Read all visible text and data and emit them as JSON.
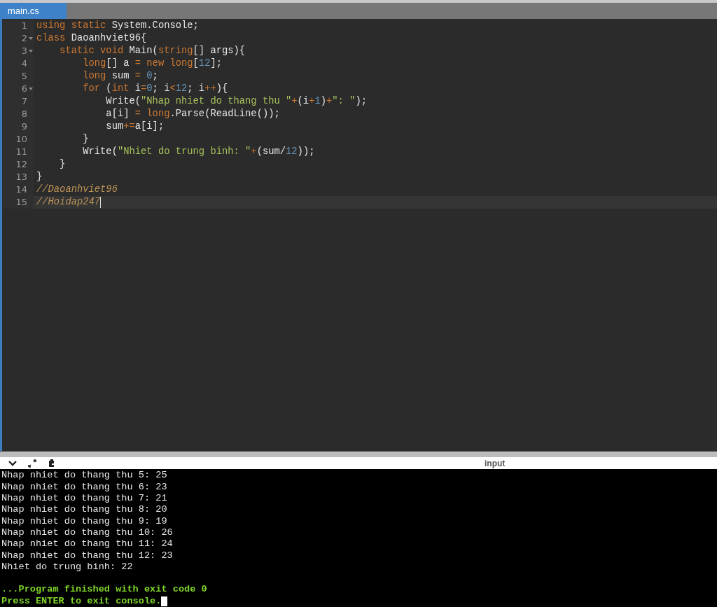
{
  "tabs": [
    {
      "label": "main.cs",
      "selected": true
    }
  ],
  "editor": {
    "lines": [
      {
        "number": "1",
        "foldable": false,
        "active": false,
        "tokens": [
          {
            "kind": "keyword",
            "text": "using static "
          },
          {
            "kind": "plain",
            "text": "System.Console;"
          }
        ]
      },
      {
        "number": "2",
        "foldable": true,
        "active": false,
        "tokens": [
          {
            "kind": "keyword",
            "text": "class "
          },
          {
            "kind": "plain",
            "text": "Daoanhviet96{"
          }
        ]
      },
      {
        "number": "3",
        "foldable": true,
        "active": false,
        "tokens": [
          {
            "kind": "keyword",
            "text": "    static void "
          },
          {
            "kind": "plain",
            "text": "Main("
          },
          {
            "kind": "keyword",
            "text": "string"
          },
          {
            "kind": "plain",
            "text": "[] args){"
          }
        ]
      },
      {
        "number": "4",
        "foldable": false,
        "active": false,
        "tokens": [
          {
            "kind": "keyword",
            "text": "        long"
          },
          {
            "kind": "plain",
            "text": "[] a "
          },
          {
            "kind": "operator",
            "text": "= "
          },
          {
            "kind": "keyword",
            "text": "new long"
          },
          {
            "kind": "plain",
            "text": "["
          },
          {
            "kind": "number",
            "text": "12"
          },
          {
            "kind": "plain",
            "text": "];"
          }
        ]
      },
      {
        "number": "5",
        "foldable": false,
        "active": false,
        "tokens": [
          {
            "kind": "keyword",
            "text": "        long "
          },
          {
            "kind": "plain",
            "text": "sum "
          },
          {
            "kind": "operator",
            "text": "= "
          },
          {
            "kind": "number",
            "text": "0"
          },
          {
            "kind": "plain",
            "text": ";"
          }
        ]
      },
      {
        "number": "6",
        "foldable": true,
        "active": false,
        "tokens": [
          {
            "kind": "keyword",
            "text": "        for "
          },
          {
            "kind": "plain",
            "text": "("
          },
          {
            "kind": "keyword",
            "text": "int "
          },
          {
            "kind": "plain",
            "text": "i"
          },
          {
            "kind": "operator",
            "text": "="
          },
          {
            "kind": "number",
            "text": "0"
          },
          {
            "kind": "plain",
            "text": "; i"
          },
          {
            "kind": "operator",
            "text": "<"
          },
          {
            "kind": "number",
            "text": "12"
          },
          {
            "kind": "plain",
            "text": "; i"
          },
          {
            "kind": "operator",
            "text": "++"
          },
          {
            "kind": "plain",
            "text": "){"
          }
        ]
      },
      {
        "number": "7",
        "foldable": false,
        "active": false,
        "tokens": [
          {
            "kind": "plain",
            "text": "            Write("
          },
          {
            "kind": "string",
            "text": "\"Nhap nhiet do thang thu \""
          },
          {
            "kind": "operator",
            "text": "+"
          },
          {
            "kind": "plain",
            "text": "(i"
          },
          {
            "kind": "operator",
            "text": "+"
          },
          {
            "kind": "number",
            "text": "1"
          },
          {
            "kind": "plain",
            "text": ")"
          },
          {
            "kind": "operator",
            "text": "+"
          },
          {
            "kind": "string",
            "text": "\": \""
          },
          {
            "kind": "plain",
            "text": ");"
          }
        ]
      },
      {
        "number": "8",
        "foldable": false,
        "active": false,
        "tokens": [
          {
            "kind": "plain",
            "text": "            a[i] "
          },
          {
            "kind": "operator",
            "text": "= "
          },
          {
            "kind": "keyword",
            "text": "long"
          },
          {
            "kind": "plain",
            "text": ".Parse(ReadLine());"
          }
        ]
      },
      {
        "number": "9",
        "foldable": false,
        "active": false,
        "tokens": [
          {
            "kind": "plain",
            "text": "            sum"
          },
          {
            "kind": "operator",
            "text": "+="
          },
          {
            "kind": "plain",
            "text": "a[i];"
          }
        ]
      },
      {
        "number": "10",
        "foldable": false,
        "active": false,
        "tokens": [
          {
            "kind": "plain",
            "text": "        }"
          }
        ]
      },
      {
        "number": "11",
        "foldable": false,
        "active": false,
        "tokens": [
          {
            "kind": "plain",
            "text": "        Write("
          },
          {
            "kind": "string",
            "text": "\"Nhiet do trung binh: \""
          },
          {
            "kind": "operator",
            "text": "+"
          },
          {
            "kind": "plain",
            "text": "(sum/"
          },
          {
            "kind": "number",
            "text": "12"
          },
          {
            "kind": "plain",
            "text": "));"
          }
        ]
      },
      {
        "number": "12",
        "foldable": false,
        "active": false,
        "tokens": [
          {
            "kind": "plain",
            "text": "    }"
          }
        ]
      },
      {
        "number": "13",
        "foldable": false,
        "active": false,
        "tokens": [
          {
            "kind": "plain",
            "text": "}"
          }
        ]
      },
      {
        "number": "14",
        "foldable": false,
        "active": false,
        "tokens": [
          {
            "kind": "comment",
            "text": "//Daoanhviet96"
          }
        ]
      },
      {
        "number": "15",
        "foldable": false,
        "active": true,
        "tokens": [
          {
            "kind": "comment",
            "text": "//Hoidap247"
          }
        ]
      }
    ]
  },
  "console": {
    "label": "input",
    "lines": [
      {
        "kind": "output",
        "text": "Nhap nhiet do thang thu 5: 25"
      },
      {
        "kind": "output",
        "text": "Nhap nhiet do thang thu 6: 23"
      },
      {
        "kind": "output",
        "text": "Nhap nhiet do thang thu 7: 21"
      },
      {
        "kind": "output",
        "text": "Nhap nhiet do thang thu 8: 20"
      },
      {
        "kind": "output",
        "text": "Nhap nhiet do thang thu 9: 19"
      },
      {
        "kind": "output",
        "text": "Nhap nhiet do thang thu 10: 26"
      },
      {
        "kind": "output",
        "text": "Nhap nhiet do thang thu 11: 24"
      },
      {
        "kind": "output",
        "text": "Nhap nhiet do thang thu 12: 23"
      },
      {
        "kind": "output",
        "text": "Nhiet do trung binh: 22"
      },
      {
        "kind": "blank"
      },
      {
        "kind": "status",
        "text": "...Program finished with exit code 0"
      },
      {
        "kind": "status",
        "text": "Press ENTER to exit console.",
        "cursor": true
      }
    ]
  }
}
